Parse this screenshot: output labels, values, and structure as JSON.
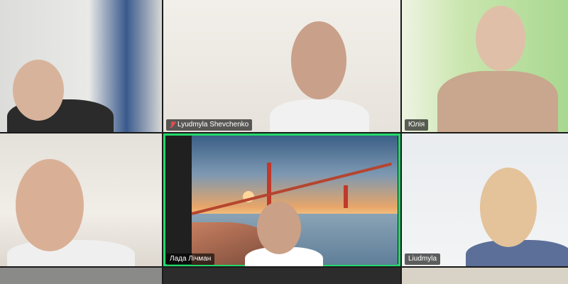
{
  "meeting": {
    "participants": [
      {
        "id": "p1",
        "name": ""
      },
      {
        "id": "p2",
        "name": "Lyudmyla Shevchenko",
        "muted": true
      },
      {
        "id": "p3",
        "name": "Юлія"
      },
      {
        "id": "p4",
        "name": ""
      },
      {
        "id": "p5",
        "name": "Лада Лічман",
        "active_speaker": true
      },
      {
        "id": "p6",
        "name": "Liudmyla"
      }
    ]
  },
  "colors": {
    "active_speaker_border": "#23d96b",
    "muted_icon": "#e34c4c",
    "label_bg": "rgba(0,0,0,0.62)"
  }
}
